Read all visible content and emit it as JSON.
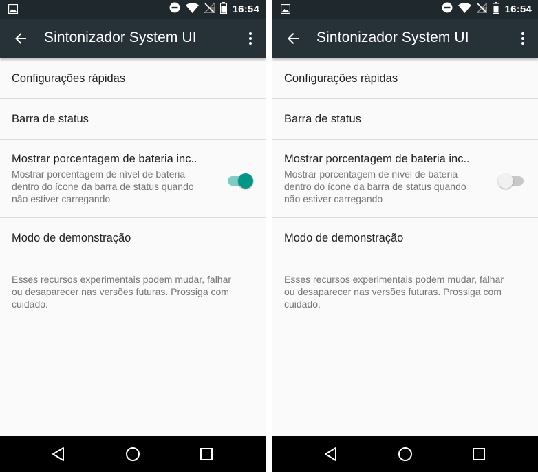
{
  "screens": [
    {
      "status": {
        "time": "16:54"
      },
      "toolbar": {
        "title": "Sintonizador System UI"
      },
      "items": [
        {
          "title": "Configurações rápidas"
        },
        {
          "title": "Barra de status"
        },
        {
          "title": "Mostrar porcentagem de bateria inc..",
          "summary": "Mostrar porcentagem de nível de bateria dentro do ícone da barra de status quando não estiver carregando",
          "switch_on": true
        },
        {
          "title": "Modo de demonstração"
        }
      ],
      "footer": "Esses recursos experimentais podem mudar, falhar ou desaparecer nas versões futuras. Prossiga com cuidado."
    },
    {
      "status": {
        "time": "16:54"
      },
      "toolbar": {
        "title": "Sintonizador System UI"
      },
      "items": [
        {
          "title": "Configurações rápidas"
        },
        {
          "title": "Barra de status"
        },
        {
          "title": "Mostrar porcentagem de bateria inc..",
          "summary": "Mostrar porcentagem de nível de bateria dentro do ícone da barra de status quando não estiver carregando",
          "switch_on": false
        },
        {
          "title": "Modo de demonstração"
        }
      ],
      "footer": "Esses recursos experimentais podem mudar, falhar ou desaparecer nas versões futuras. Prossiga com cuidado."
    }
  ],
  "icons": {
    "statusbar": [
      "image-icon",
      "do-not-disturb-icon",
      "wifi-icon",
      "no-signal-icon",
      "battery-icon"
    ],
    "toolbar": [
      "back-arrow-icon",
      "overflow-menu-icon"
    ],
    "navbar": [
      "nav-back-icon",
      "nav-home-icon",
      "nav-recents-icon"
    ]
  },
  "colors": {
    "toolbar": "#263238",
    "statusbar": "#1f282c",
    "accent": "#009688",
    "accent_track": "#80cbc4",
    "background": "#fafafa",
    "navbar": "#000000"
  }
}
